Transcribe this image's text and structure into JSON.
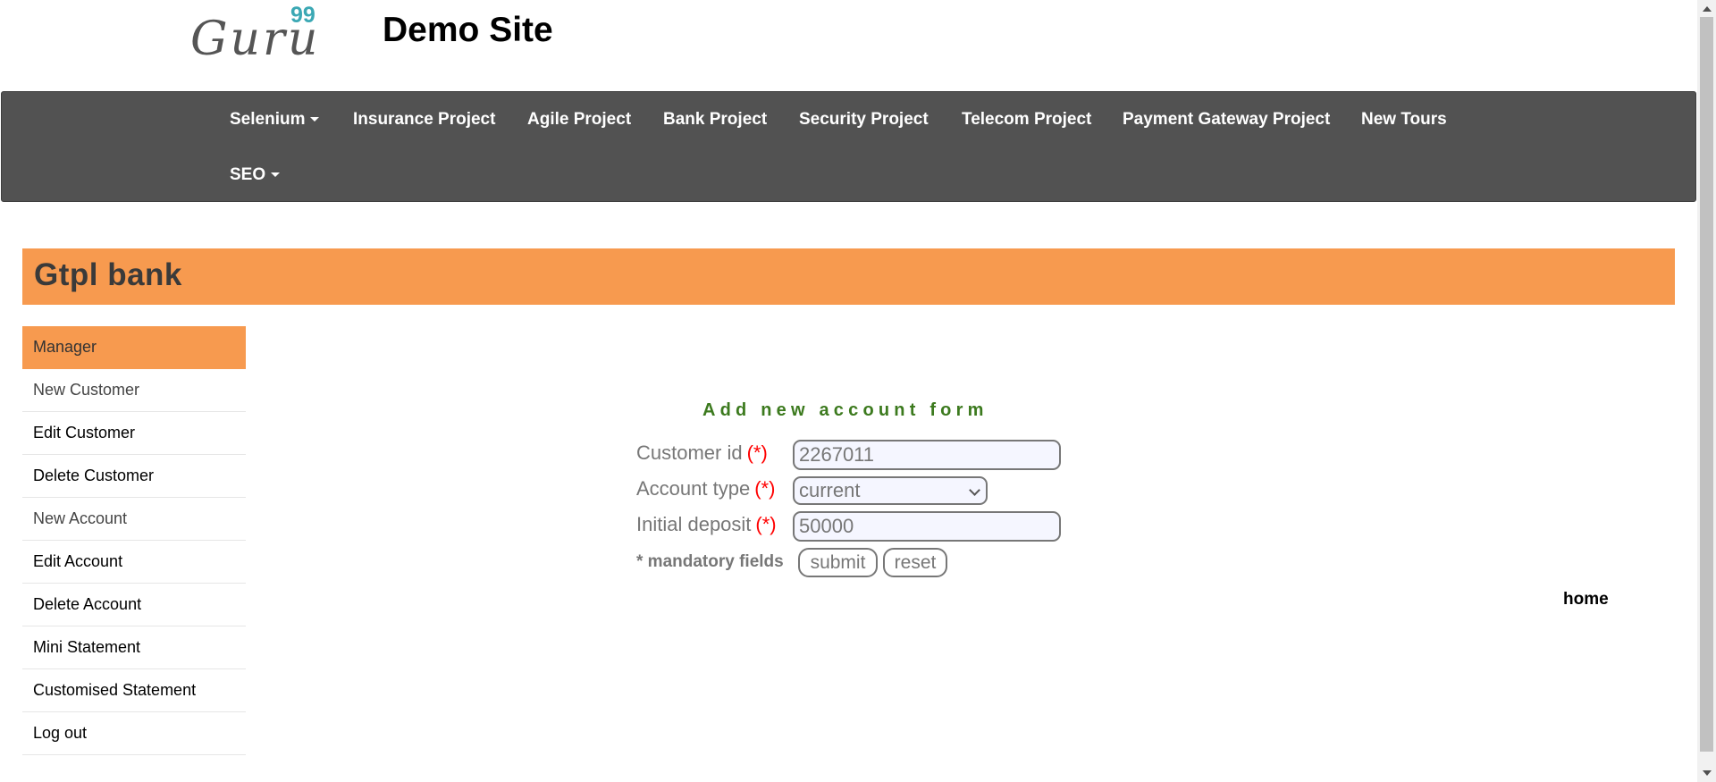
{
  "header": {
    "logo_text": "Guru",
    "logo_superscript": "99",
    "site_title": "Demo Site"
  },
  "navbar": {
    "items": [
      {
        "label": "Selenium",
        "has_dropdown": true
      },
      {
        "label": "Insurance Project"
      },
      {
        "label": "Agile Project"
      },
      {
        "label": "Bank Project"
      },
      {
        "label": "Security Project"
      },
      {
        "label": "Telecom Project"
      },
      {
        "label": "Payment Gateway Project"
      },
      {
        "label": "New Tours"
      },
      {
        "label": "SEO",
        "has_dropdown": true
      }
    ]
  },
  "bank": {
    "name": "Gtpl bank"
  },
  "sidebar": {
    "items": [
      {
        "label": "Manager"
      },
      {
        "label": "New Customer"
      },
      {
        "label": "Edit Customer"
      },
      {
        "label": "Delete Customer"
      },
      {
        "label": "New Account"
      },
      {
        "label": "Edit Account"
      },
      {
        "label": "Delete Account"
      },
      {
        "label": "Mini Statement"
      },
      {
        "label": "Customised Statement"
      },
      {
        "label": "Log out"
      }
    ]
  },
  "form": {
    "heading": "Add new account form",
    "required_marker": "(*)",
    "customer_id": {
      "label": "Customer id",
      "value": "2267011"
    },
    "account_type": {
      "label": "Account type",
      "value": "current"
    },
    "initial_deposit": {
      "label": "Initial deposit",
      "value": "50000"
    },
    "mandatory_note": "* mandatory fields",
    "submit_label": "submit",
    "reset_label": "reset"
  },
  "home_link": "home",
  "colors": {
    "navbar_bg": "#525252",
    "accent_orange": "#f79a4f",
    "form_heading_green": "#3c7a1e",
    "required_red": "#ff0000",
    "logo_teal": "#3ba8b4"
  }
}
